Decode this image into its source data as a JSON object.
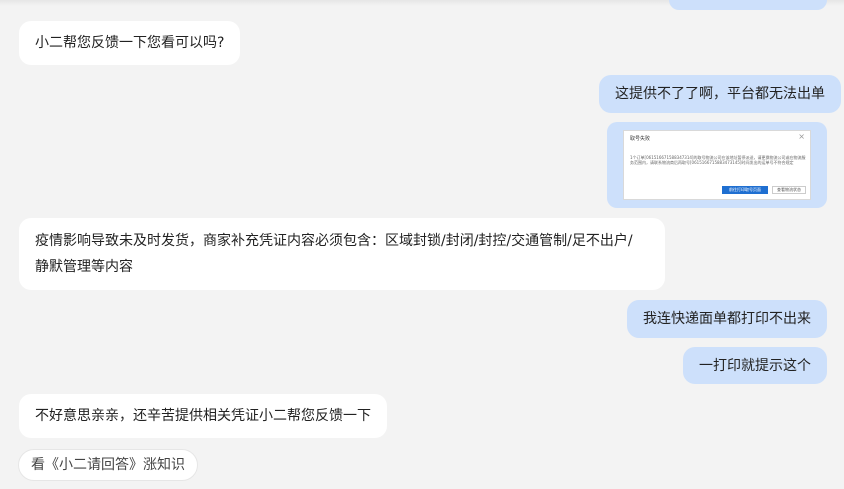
{
  "messages": [
    {
      "side": "left",
      "text": "小二帮您反馈一下您看可以吗?"
    },
    {
      "side": "right",
      "text": "这提供不了了啊，平台都无法出单"
    },
    {
      "side": "right",
      "type": "image",
      "dialog": {
        "title": "取号失败",
        "body": "1个订单[061516671588347314]的取号物流公司在该地址暂停派送，请更换物流公司或在物流服务范围内，请联系物流商后再取号[0615166715883473145]时间发出的运单号不符合规定",
        "primary": "前往打印取号页面",
        "secondary": "查看物流状态"
      }
    },
    {
      "side": "left",
      "line1": "疫情影响导致未及时发货，商家补充凭证内容必须包含：区域封锁/封闭/封控/交通管制/足不出户/",
      "line2": "静默管理等内容"
    },
    {
      "side": "right",
      "text": "我连快递面单都打印不出来"
    },
    {
      "side": "right",
      "text": "一打印就提示这个"
    },
    {
      "side": "left",
      "text": "不好意思亲亲，还辛苦提供相关凭证小二帮您反馈一下"
    }
  ],
  "suggestion": {
    "text": "看《小二请回答》涨知识"
  },
  "colors": {
    "background": "#f3f3f3",
    "agent_bubble": "#ffffff",
    "user_bubble": "#cde0fb",
    "primary_button": "#1f6fd1"
  }
}
